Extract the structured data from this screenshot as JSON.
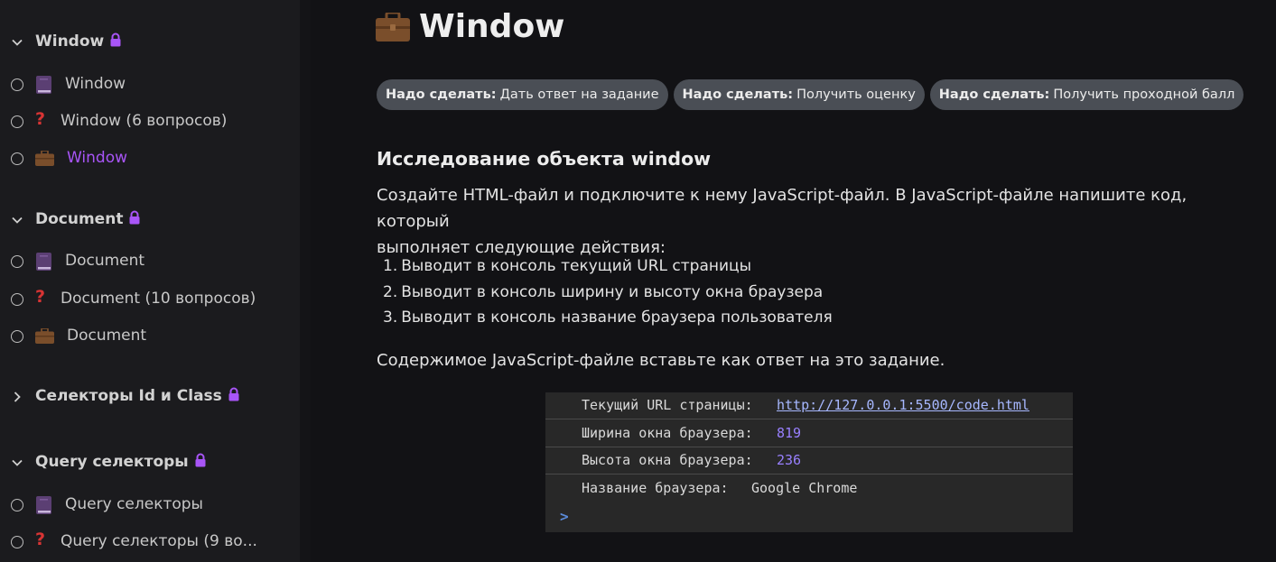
{
  "sidebar": {
    "sections": [
      {
        "title": "Window",
        "expanded": true,
        "items": [
          {
            "label": "Window",
            "icon": "book-icon"
          },
          {
            "label": "Window (6 вопросов)",
            "icon": "question-icon"
          },
          {
            "label": "Window",
            "icon": "briefcase-icon",
            "active": true
          }
        ]
      },
      {
        "title": "Document",
        "expanded": true,
        "items": [
          {
            "label": "Document",
            "icon": "book-icon"
          },
          {
            "label": "Document (10 вопросов)",
            "icon": "question-icon"
          },
          {
            "label": "Document",
            "icon": "briefcase-icon"
          }
        ]
      },
      {
        "title": "Селекторы Id и Class",
        "expanded": false,
        "items": []
      },
      {
        "title": "Query селекторы",
        "expanded": true,
        "items": [
          {
            "label": "Query селекторы",
            "icon": "book-icon"
          },
          {
            "label": "Query селекторы (9 во...",
            "icon": "question-icon"
          }
        ]
      }
    ]
  },
  "main": {
    "title": "Window",
    "tags": [
      {
        "prefix": "Надо сделать:",
        "text": "Дать ответ на задание"
      },
      {
        "prefix": "Надо сделать:",
        "text": "Получить оценку"
      },
      {
        "prefix": "Надо сделать:",
        "text": "Получить проходной балл"
      }
    ],
    "heading": "Исследование объекта window",
    "intro_line1": "Создайте HTML-файл и подключите к нему JavaScript-файл. В JavaScript-файле напишите код, который",
    "intro_line2": "выполняет следующие действия:",
    "steps": [
      "Выводит в консоль текущий URL страницы",
      "Выводит в консоль ширину и высоту окна браузера",
      "Выводит в консоль название браузера пользователя"
    ],
    "step_numbers": [
      "1.",
      "2.",
      "3."
    ],
    "outro": "Содержимое JavaScript-файле вставьте как ответ на это задание.",
    "console": {
      "rows": [
        {
          "key": "Текущий URL страницы:",
          "value": "http://127.0.0.1:5500/code.html"
        },
        {
          "key": "Ширина окна браузера:",
          "value": "819"
        },
        {
          "key": "Высота окна браузера:",
          "value": "236"
        },
        {
          "key": "Название браузера:",
          "value": "Google Chrome"
        }
      ],
      "prompt": ">"
    }
  },
  "colors": {
    "accent": "#a855f7",
    "background": "#121215",
    "sidebar": "#1b1b1e",
    "tag_bg": "#4a4e55",
    "console_bg": "#282828"
  }
}
